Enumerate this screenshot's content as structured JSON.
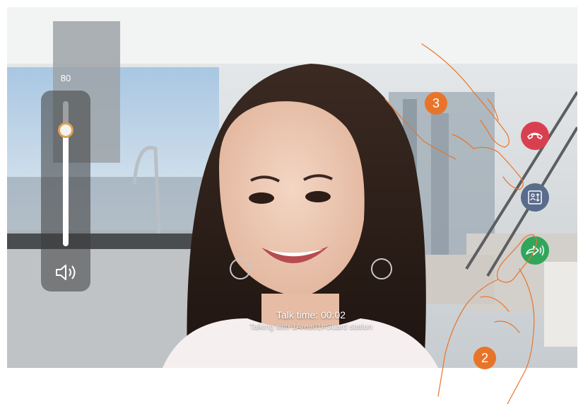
{
  "volume": {
    "value": "80",
    "level": 0.8
  },
  "call": {
    "talk_time": "Talk time: 00:02",
    "talking_with": "Talking with 1Area01#Guard station"
  },
  "buttons": {
    "hangup_icon": "phone-hangup-icon",
    "contacts_icon": "contacts-list-icon",
    "transfer_icon": "call-transfer-icon"
  },
  "steps": {
    "step_3": "3",
    "step_2": "2"
  },
  "colors": {
    "hangup": "#d9404f",
    "contacts": "#5a6c8c",
    "transfer": "#2fa65a",
    "step_badge": "#e8742a",
    "hand_outline": "#e8742a"
  }
}
